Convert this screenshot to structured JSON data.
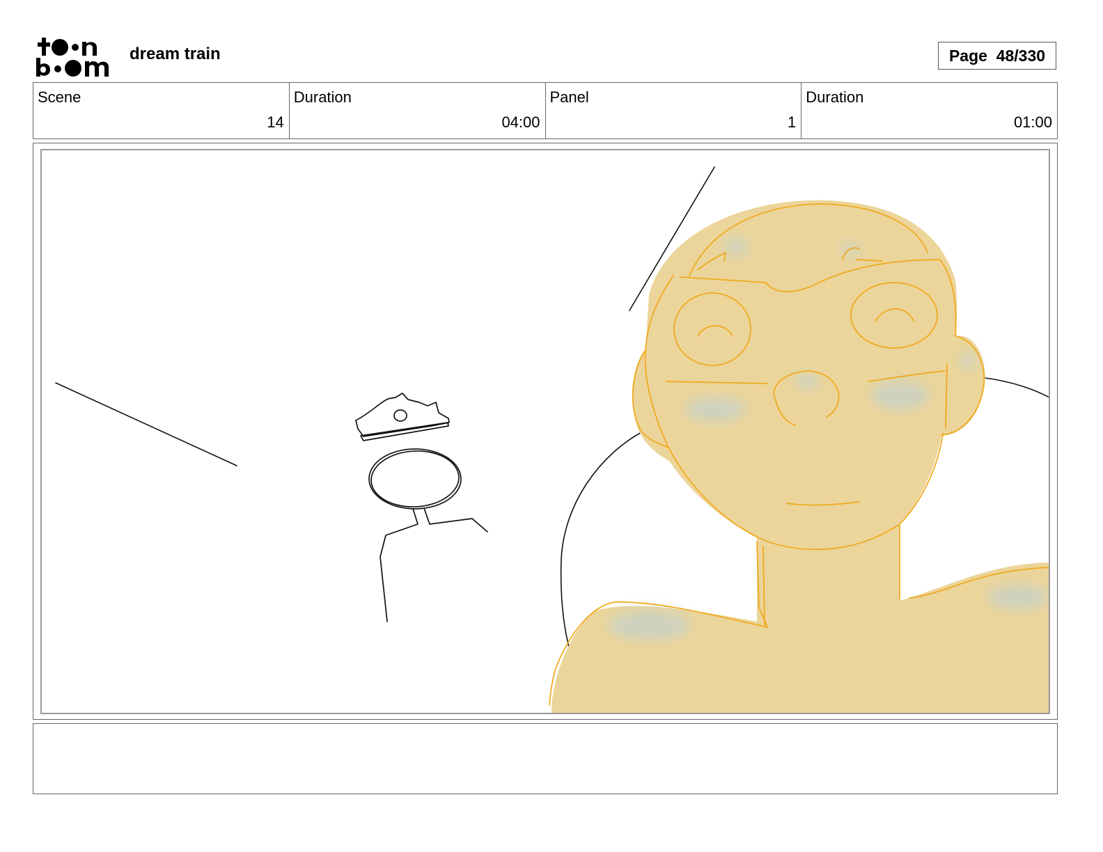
{
  "header": {
    "logo_name": "toon boom",
    "project_title": "dream train",
    "page_label": "Page",
    "page_number": "48/330"
  },
  "info": [
    {
      "label": "Scene",
      "value": "14"
    },
    {
      "label": "Duration",
      "value": "04:00"
    },
    {
      "label": "Panel",
      "value": "1"
    },
    {
      "label": "Duration",
      "value": "01:00"
    }
  ],
  "panel": {
    "colors": {
      "skin": "#ecd59a",
      "outline": "#f0a81a",
      "shadow": "#c9d2c6",
      "ink": "#111111"
    }
  },
  "notes": {
    "text": ""
  }
}
